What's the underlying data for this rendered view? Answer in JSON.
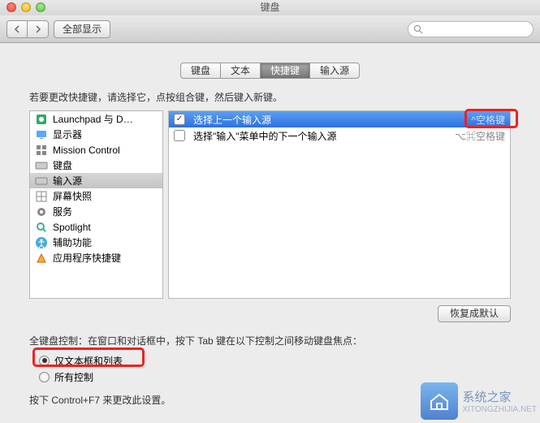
{
  "title": "键盘",
  "toolbar": {
    "show_all": "全部显示"
  },
  "tabs": [
    {
      "label": "键盘"
    },
    {
      "label": "文本"
    },
    {
      "label": "快捷键"
    },
    {
      "label": "输入源"
    }
  ],
  "active_tab_index": 2,
  "instruction": "若要更改快捷键，请选择它，点按组合键，然后键入新键。",
  "sidebar": {
    "selected_index": 4,
    "items": [
      {
        "label": "Launchpad 与 D…",
        "icon": "launchpad"
      },
      {
        "label": "显示器",
        "icon": "display"
      },
      {
        "label": "Mission Control",
        "icon": "mission"
      },
      {
        "label": "键盘",
        "icon": "keyboard"
      },
      {
        "label": "输入源",
        "icon": "keyboard"
      },
      {
        "label": "屏幕快照",
        "icon": "grid"
      },
      {
        "label": "服务",
        "icon": "gear"
      },
      {
        "label": "Spotlight",
        "icon": "spotlight"
      },
      {
        "label": "辅助功能",
        "icon": "accessibility"
      },
      {
        "label": "应用程序快捷键",
        "icon": "apps"
      }
    ]
  },
  "shortcuts": {
    "rows": [
      {
        "checked": true,
        "label": "选择上一个输入源",
        "key": "^空格键",
        "selected": true
      },
      {
        "checked": false,
        "label": "选择\"输入\"菜单中的下一个输入源",
        "key": "⌥⌘空格键",
        "selected": false
      }
    ]
  },
  "restore_button": "恢复成默认",
  "keyboard_access": {
    "label": "全键盘控制：在窗口和对话框中，按下 Tab 键在以下控制之间移动键盘焦点：",
    "options": [
      {
        "label": "仅文本框和列表",
        "checked": true
      },
      {
        "label": "所有控制",
        "checked": false
      }
    ],
    "hint": "按下 Control+F7 来更改此设置。"
  },
  "watermark": {
    "name": "系统之家",
    "url": "XITONGZHIJIA.NET"
  }
}
